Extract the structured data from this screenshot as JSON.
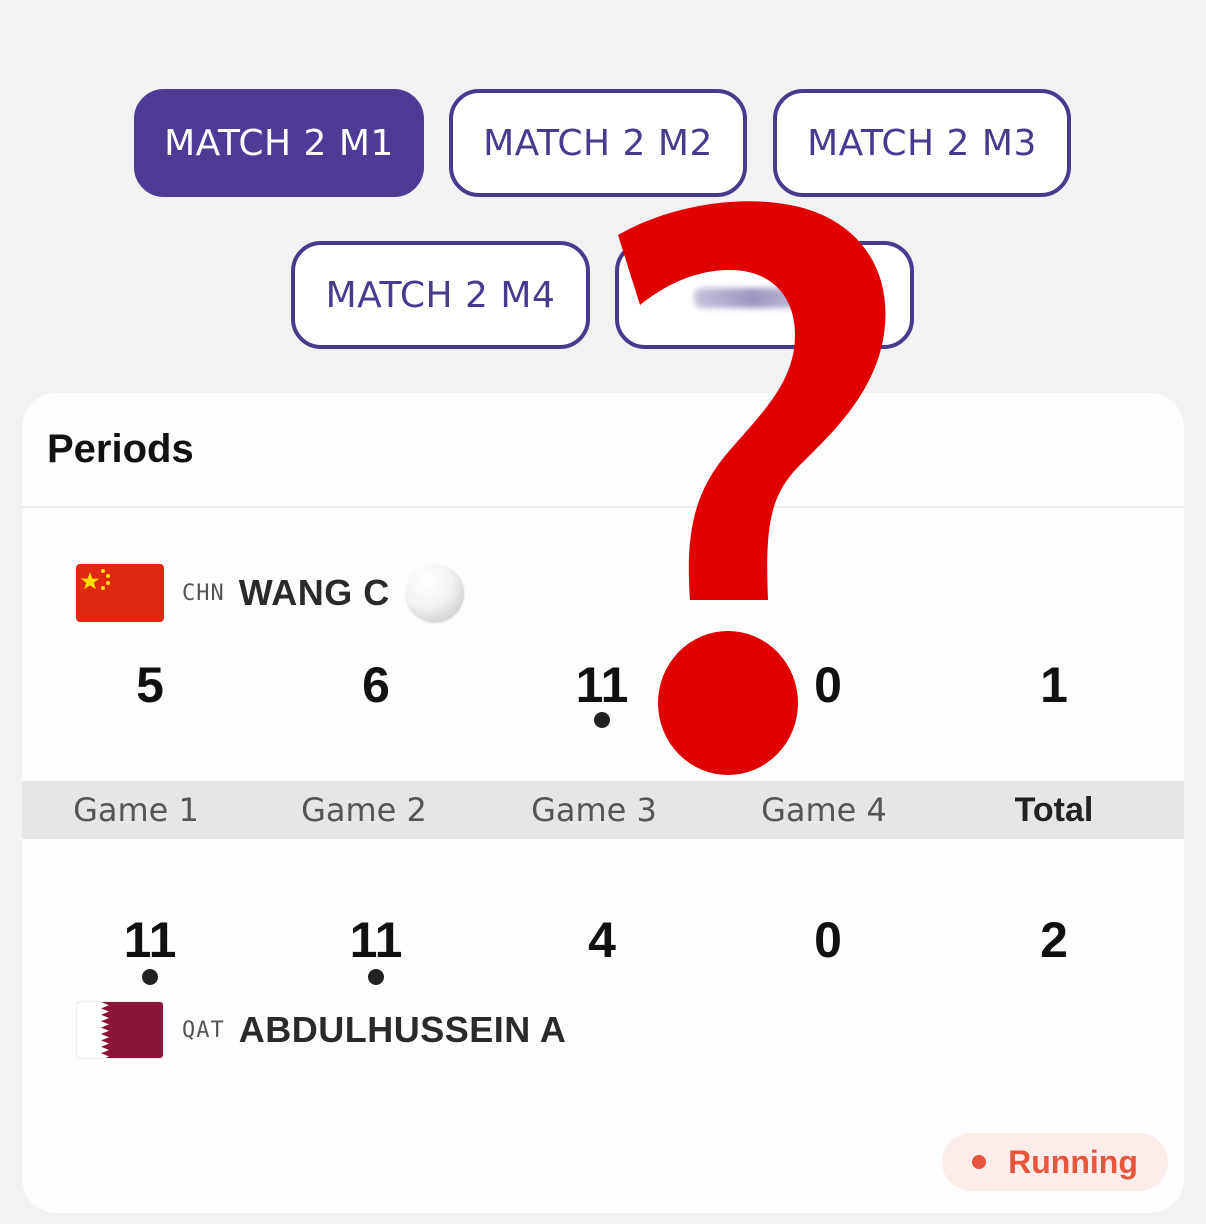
{
  "tabs": [
    {
      "label": "MATCH 2 M1",
      "active": true
    },
    {
      "label": "MATCH 2 M2",
      "active": false
    },
    {
      "label": "MATCH 2 M3",
      "active": false
    },
    {
      "label": "MATCH 2 M4",
      "active": false
    }
  ],
  "periods": {
    "title": "Periods",
    "player1": {
      "country": "CHN",
      "name": "WANG C",
      "serving": true,
      "scores": [
        "5",
        "6",
        "11",
        "0",
        "1"
      ],
      "game_winner": [
        false,
        false,
        true,
        false
      ]
    },
    "games": [
      "Game 1",
      "Game 2",
      "Game 3",
      "Game 4",
      "Total"
    ],
    "player2": {
      "country": "QAT",
      "name": "ABDULHUSSEIN A",
      "serving": false,
      "scores": [
        "11",
        "11",
        "4",
        "0",
        "2"
      ],
      "game_winner": [
        true,
        true,
        false,
        false
      ]
    },
    "status": "Running"
  },
  "colors": {
    "accent": "#4d3b95",
    "status": "#e8553e",
    "overlay": "#e00000"
  }
}
